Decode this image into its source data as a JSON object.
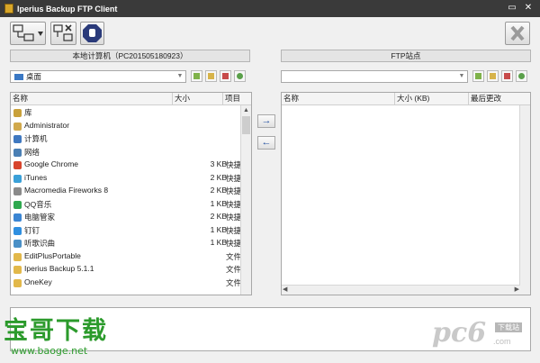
{
  "window": {
    "title": "Iperius Backup FTP Client",
    "minimize_glyph": "▭",
    "close_glyph": "✕"
  },
  "toolbar": {
    "connect_icon": "network-connect-icon",
    "disconnect_icon": "network-disconnect-icon",
    "stop_icon": "stop-hand-icon",
    "exit_icon": "close-x-icon"
  },
  "local_panel": {
    "header": "本地计算机（PC201505180923）",
    "path": "桌面",
    "columns": [
      "名称",
      "大小",
      "项目"
    ],
    "rows": [
      {
        "icon": "library-icon",
        "color": "#c9a13b",
        "name": "库",
        "size": "",
        "type": ""
      },
      {
        "icon": "user-folder-icon",
        "color": "#d1a94d",
        "name": "Administrator",
        "size": "",
        "type": ""
      },
      {
        "icon": "computer-icon",
        "color": "#3f78c0",
        "name": "计算机",
        "size": "",
        "type": ""
      },
      {
        "icon": "network-icon",
        "color": "#4a7fb4",
        "name": "网络",
        "size": "",
        "type": ""
      },
      {
        "icon": "chrome-icon",
        "color": "#d8442c",
        "name": "Google Chrome",
        "size": "3 KB",
        "type": "快捷"
      },
      {
        "icon": "itunes-icon",
        "color": "#3aa0d8",
        "name": "iTunes",
        "size": "2 KB",
        "type": "快捷"
      },
      {
        "icon": "fireworks-icon",
        "color": "#8a8a8a",
        "name": "Macromedia Fireworks 8",
        "size": "2 KB",
        "type": "快捷"
      },
      {
        "icon": "qq-music-icon",
        "color": "#2fa84f",
        "name": "QQ音乐",
        "size": "1 KB",
        "type": "快捷"
      },
      {
        "icon": "pc-manager-icon",
        "color": "#3b85d3",
        "name": "电脑管家",
        "size": "2 KB",
        "type": "快捷"
      },
      {
        "icon": "dingtalk-icon",
        "color": "#2f8fe0",
        "name": "钉钉",
        "size": "1 KB",
        "type": "快捷"
      },
      {
        "icon": "music-recognition-icon",
        "color": "#4a90c7",
        "name": "听歌识曲",
        "size": "1 KB",
        "type": "快捷"
      },
      {
        "icon": "folder-icon",
        "color": "#e2b84a",
        "name": "EditPlusPortable",
        "size": "",
        "type": "文件"
      },
      {
        "icon": "folder-icon",
        "color": "#e2b84a",
        "name": "Iperius Backup 5.1.1",
        "size": "",
        "type": "文件"
      },
      {
        "icon": "folder-icon",
        "color": "#e2b84a",
        "name": "OneKey",
        "size": "",
        "type": "文件"
      }
    ]
  },
  "ftp_panel": {
    "header": "FTP站点",
    "path": "",
    "columns": [
      "名称",
      "大小 (KB)",
      "最后更改"
    ]
  },
  "transfer": {
    "upload": "→",
    "download": "←"
  },
  "watermark": {
    "site_name": "宝哥下载",
    "site_url": "www.baoge.net",
    "right_logo": "pc6",
    "right_tag": "下载站",
    "right_domain": ".com"
  }
}
